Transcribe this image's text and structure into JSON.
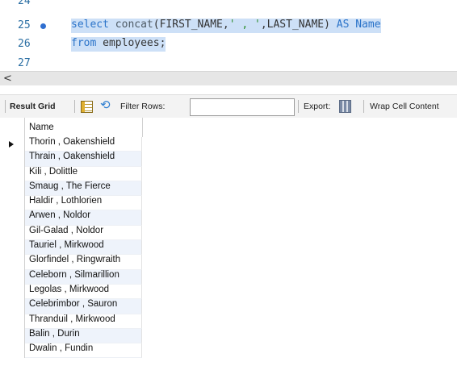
{
  "editor": {
    "lines": [
      {
        "num": "24",
        "text": ""
      },
      {
        "num": "25",
        "kw1": "select",
        "fn": " concat",
        "p1": "(FIRST_NAME,",
        "str": "' , '",
        "p2": ",LAST_NAME) ",
        "kw2": "AS",
        "sp": " ",
        "kw3": "Name"
      },
      {
        "num": "26",
        "kw1": "from",
        "rest": " employees;"
      },
      {
        "num": "27",
        "text": ""
      }
    ]
  },
  "scrollbar": {
    "left_arrow": "<"
  },
  "toolbar": {
    "result_grid_label": "Result Grid",
    "filter_rows_label": "Filter Rows:",
    "filter_value": "",
    "export_label": "Export:",
    "wrap_label": "Wrap Cell Content",
    "grid_icon": "grid-layout-icon",
    "refresh_icon": "refresh-icon",
    "export_icon": "export-icon"
  },
  "grid": {
    "columns": [
      "Name"
    ],
    "selected_row_index": 0,
    "rows": [
      "Thorin , Oakenshield",
      "Thrain , Oakenshield",
      "Kili , Dolittle",
      "Smaug , The Fierce",
      "Haldir , Lothlorien",
      "Arwen , Noldor",
      "Gil-Galad , Noldor",
      "Tauriel , Mirkwood",
      "Glorfindel , Ringwraith",
      "Celeborn , Silmarillion",
      "Legolas , Mirkwood",
      "Celebrimbor , Sauron",
      "Thranduil , Mirkwood",
      "Balin , Durin",
      "Dwalin , Fundin"
    ]
  },
  "colors": {
    "keyword": "#2a73c9",
    "string": "#2f8f2f",
    "selection": "#cde0f7",
    "alt_row": "#eef3fb"
  }
}
